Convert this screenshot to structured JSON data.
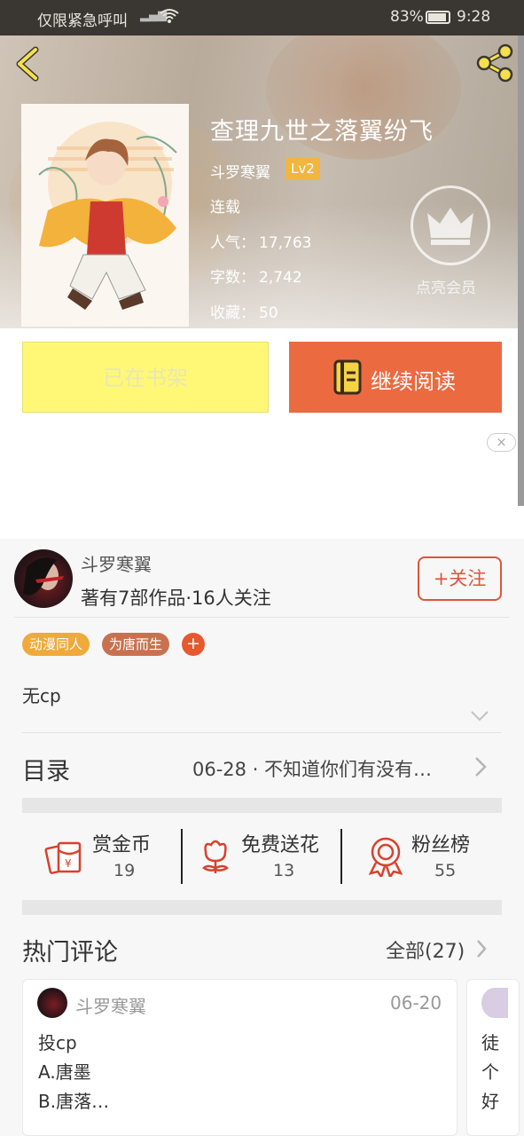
{
  "status_bar": {
    "carrier_text": "仅限紧急呼叫",
    "battery": "83%",
    "time": "9:28"
  },
  "book": {
    "title": "查理九世之落翼纷飞",
    "author": "斗罗寒翼",
    "level": "Lv2",
    "status": "连载",
    "popularity_label": "人气：",
    "popularity_value": "17,763",
    "word_count_label": "字数：",
    "word_count_value": "2,742",
    "favorites_label": "收藏：",
    "favorites_value": "50",
    "vip_label": "点亮会员"
  },
  "actions": {
    "shelf_button": "已在书架",
    "read_button": "继续阅读"
  },
  "ad": {
    "close_label": "×"
  },
  "author_info": {
    "name": "斗罗寒翼",
    "stats": "著有7部作品·16人关注",
    "follow_button": "+关注"
  },
  "tags": [
    {
      "label": "动漫同人",
      "color": "#f0a93a"
    },
    {
      "label": "为唐而生",
      "color": "#c9714f"
    }
  ],
  "tag_add": "+",
  "description": "无cp",
  "toc": {
    "title": "目录",
    "latest": "06-28 · 不知道你们有没有…"
  },
  "stats": [
    {
      "label": "赏金币",
      "value": "19",
      "icon": "red-envelope-icon"
    },
    {
      "label": "免费送花",
      "value": "13",
      "icon": "flower-icon"
    },
    {
      "label": "粉丝榜",
      "value": "55",
      "icon": "medal-icon"
    }
  ],
  "hot_comments": {
    "title": "热门评论",
    "all_label": "全部(27)",
    "cards": [
      {
        "user": "斗罗寒翼",
        "date": "06-20",
        "lines": [
          "投cp",
          "A.唐墨",
          "B.唐落…"
        ]
      },
      {
        "lines": [
          "徒",
          "个",
          "好"
        ]
      }
    ]
  },
  "colors": {
    "accent_orange": "#ec6a40",
    "shelf_yellow": "#fff876",
    "follow_red": "#e2533b",
    "level_badge": "#f0b63f"
  }
}
